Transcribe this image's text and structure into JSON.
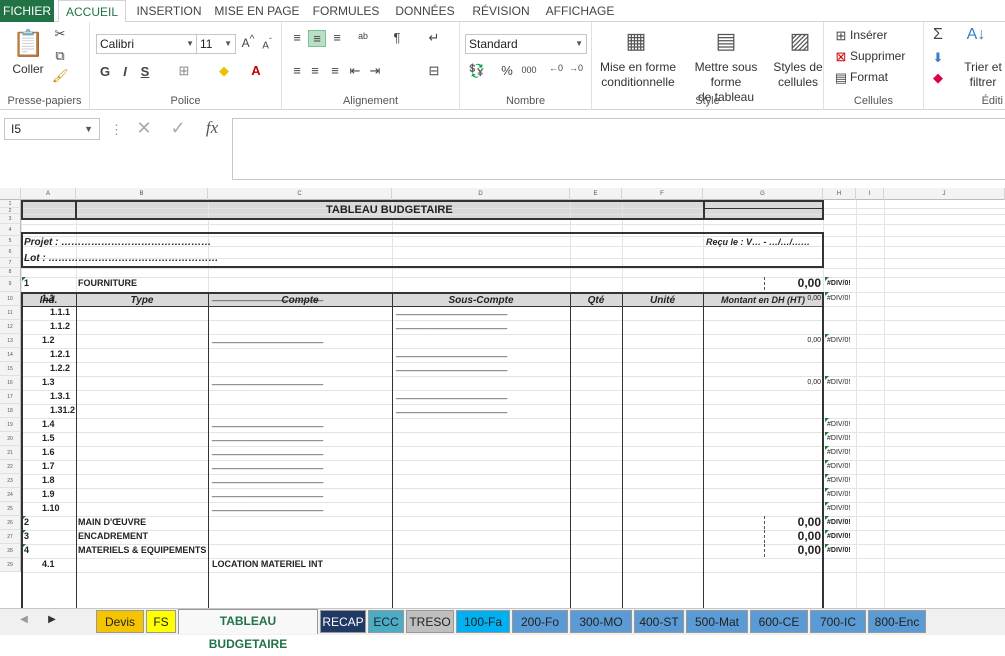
{
  "ribbon_tabs": [
    "FICHIER",
    "ACCUEIL",
    "INSERTION",
    "MISE EN PAGE",
    "FORMULES",
    "DONNÉES",
    "RÉVISION",
    "AFFICHAGE"
  ],
  "clipboard": {
    "paste_label": "Coller",
    "group_label": "Presse-papiers"
  },
  "font": {
    "name": "Calibri",
    "size": "11",
    "group_label": "Police",
    "bold": "G",
    "italic": "I",
    "underline": "S"
  },
  "alignment": {
    "group_label": "Alignement"
  },
  "number": {
    "format": "Standard",
    "group_label": "Nombre",
    "percent": "%",
    "thousands": "000"
  },
  "styles": {
    "conditional": [
      "Mise en forme",
      "conditionnelle"
    ],
    "table": [
      "Mettre sous forme",
      "de tableau"
    ],
    "cell_styles": [
      "Styles de",
      "cellules"
    ],
    "group_label": "Style"
  },
  "cells": {
    "insert": "Insérer",
    "delete": "Supprimer",
    "format": "Format",
    "group_label": "Cellules"
  },
  "editing": {
    "sort": [
      "Trier et",
      "filtrer"
    ],
    "group_label": "Éditi"
  },
  "namebox": "I5",
  "fx": "fx",
  "columns": [
    "A",
    "B",
    "C",
    "D",
    "E",
    "F",
    "G",
    "H",
    "I",
    "J"
  ],
  "sheet": {
    "title": "TABLEAU BUDGETAIRE",
    "projet": "Projet : ………………………………………",
    "lot": "Lot : ……………………………………………",
    "recu": "Reçu le : V… - …/…/……",
    "headers": [
      "Ind.",
      "Type",
      "Compte",
      "Sous-Compte",
      "Qté",
      "Unité",
      "Montant en DH (HT)"
    ],
    "dashes": "____________________",
    "rows": [
      {
        "ind": "1",
        "type": "FOURNITURE",
        "montant": "0,00",
        "h": "#DIV/0!"
      },
      {
        "ind": "1.1",
        "compte": true,
        "montant": "0,00",
        "h": "#DIV/0!"
      },
      {
        "ind": "1.1.1",
        "sous": true
      },
      {
        "ind": "1.1.2",
        "sous": true
      },
      {
        "ind": "1.2",
        "compte": true,
        "montant": "0,00",
        "h": "#DIV/0!"
      },
      {
        "ind": "1.2.1",
        "sous": true
      },
      {
        "ind": "1.2.2",
        "sous": true
      },
      {
        "ind": "1.3",
        "compte": true,
        "montant": "0,00",
        "h": "#DIV/0!"
      },
      {
        "ind": "1.3.1",
        "sous": true
      },
      {
        "ind": "1.31.2",
        "sous": true
      },
      {
        "ind": "1.4",
        "compte": true,
        "h": "#DIV/0!"
      },
      {
        "ind": "1.5",
        "compte": true,
        "h": "#DIV/0!"
      },
      {
        "ind": "1.6",
        "compte": true,
        "h": "#DIV/0!"
      },
      {
        "ind": "1.7",
        "compte": true,
        "h": "#DIV/0!"
      },
      {
        "ind": "1.8",
        "compte": true,
        "h": "#DIV/0!"
      },
      {
        "ind": "1.9",
        "compte": true,
        "h": "#DIV/0!"
      },
      {
        "ind": "1.10",
        "compte": true,
        "h": "#DIV/0!"
      },
      {
        "ind": "2",
        "type": "MAIN D'ŒUVRE",
        "montant": "0,00",
        "h": "#DIV/0!"
      },
      {
        "ind": "3",
        "type": "ENCADREMENT",
        "montant": "0,00",
        "h": "#DIV/0!"
      },
      {
        "ind": "4",
        "type": "MATERIELS & EQUIPEMENTS",
        "montant": "0,00",
        "h": "#DIV/0!"
      },
      {
        "ind": "4.1",
        "compte_text": "LOCATION MATERIEL INT"
      }
    ]
  },
  "sheet_tabs": [
    {
      "name": "Devis",
      "color": "#f5c400"
    },
    {
      "name": "FS",
      "color": "#ffff00"
    },
    {
      "name": "TABLEAU BUDGETAIRE",
      "color": "#f8f8f8",
      "active": true
    },
    {
      "name": "RECAP",
      "color": "#1f3864",
      "text": "#ffffff"
    },
    {
      "name": "ECC",
      "color": "#4bacc6"
    },
    {
      "name": "TRESO",
      "color": "#bfbfbf"
    },
    {
      "name": "100-Fa",
      "color": "#00b0f0"
    },
    {
      "name": "200-Fo",
      "color": "#5b9bd5"
    },
    {
      "name": "300-MO",
      "color": "#5b9bd5"
    },
    {
      "name": "400-ST",
      "color": "#5b9bd5"
    },
    {
      "name": "500-Mat",
      "color": "#5b9bd5"
    },
    {
      "name": "600-CE",
      "color": "#5b9bd5"
    },
    {
      "name": "700-IC",
      "color": "#5b9bd5"
    },
    {
      "name": "800-Enc",
      "color": "#5b9bd5"
    }
  ]
}
